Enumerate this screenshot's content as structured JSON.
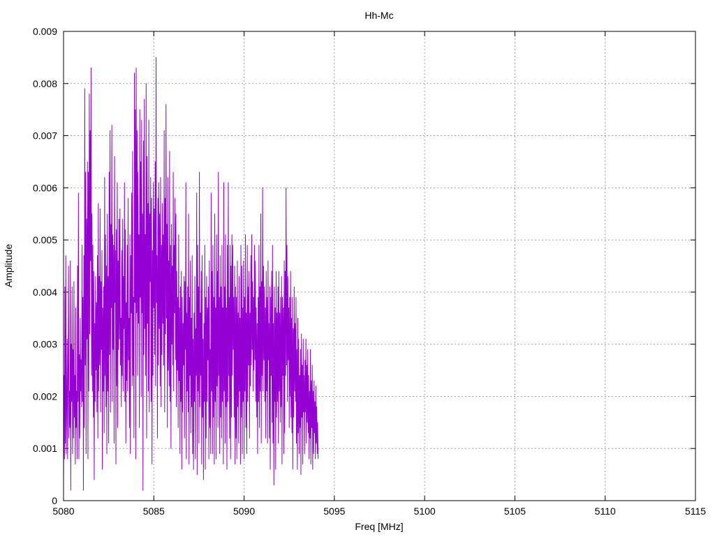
{
  "chart_data": {
    "type": "line",
    "title": "Hh-Mc",
    "xlabel": "Freq [MHz]",
    "ylabel": "Amplitude",
    "xlim": [
      5080,
      5115
    ],
    "ylim": [
      0,
      0.009
    ],
    "x_ticks": [
      5080,
      5085,
      5090,
      5095,
      5100,
      5105,
      5110,
      5115
    ],
    "y_ticks": [
      0,
      0.001,
      0.002,
      0.003,
      0.004,
      0.005,
      0.006,
      0.007,
      0.008,
      0.009
    ],
    "x_tick_labels": [
      "5080",
      "5085",
      "5090",
      "5095",
      "5100",
      "5105",
      "5110",
      "5115"
    ],
    "y_tick_labels": [
      "0",
      "0.001",
      "0.002",
      "0.003",
      "0.004",
      "0.005",
      "0.006",
      "0.007",
      "0.008",
      "0.009"
    ],
    "grid": true,
    "grid_style": "dotted",
    "line_color": "#9400d3",
    "series": [
      {
        "x_start": 5080.0,
        "x_step": 0.025,
        "values": [
          0.0004,
          0.0024,
          0.0008,
          0.0041,
          0.0011,
          0.0047,
          0.0009,
          0.0018,
          0.0031,
          0.0008,
          0.0024,
          0.0045,
          0.0012,
          0.0021,
          0.0014,
          0.0046,
          0.0002,
          0.003,
          0.0019,
          0.0041,
          0.0009,
          0.0029,
          0.0012,
          0.0042,
          0.0016,
          0.0024,
          0.0007,
          0.0037,
          0.0014,
          0.0021,
          0.0008,
          0.0045,
          0.0019,
          0.0059,
          0.0008,
          0.0028,
          0.0012,
          0.0035,
          0.0021,
          0.0027,
          0.0018,
          0.0049,
          0.0019,
          0.0039,
          0.0002,
          0.0047,
          0.0014,
          0.0079,
          0.0026,
          0.0063,
          0.0009,
          0.0054,
          0.0031,
          0.0065,
          0.0008,
          0.0063,
          0.0021,
          0.0078,
          0.0032,
          0.0071,
          0.0046,
          0.0083,
          0.0024,
          0.0055,
          0.0021,
          0.0049,
          0.0016,
          0.0044,
          0.0004,
          0.0034,
          0.0019,
          0.0043,
          0.0025,
          0.0038,
          0.0017,
          0.0047,
          0.0012,
          0.0057,
          0.0021,
          0.0043,
          0.0026,
          0.0056,
          0.0017,
          0.0042,
          0.0029,
          0.0048,
          0.0006,
          0.0037,
          0.0021,
          0.0041,
          0.0013,
          0.0062,
          0.0024,
          0.0051,
          0.0018,
          0.0045,
          0.0009,
          0.0055,
          0.0021,
          0.0043,
          0.0011,
          0.0063,
          0.0028,
          0.0071,
          0.0017,
          0.0053,
          0.0037,
          0.0072,
          0.0019,
          0.0051,
          0.0029,
          0.0049,
          0.0011,
          0.0066,
          0.0038,
          0.0048,
          0.0007,
          0.0052,
          0.0022,
          0.0061,
          0.0014,
          0.0046,
          0.0029,
          0.0054,
          0.0031,
          0.0056,
          0.0026,
          0.0035,
          0.0018,
          0.0048,
          0.0024,
          0.0054,
          0.0021,
          0.0043,
          0.0033,
          0.0061,
          0.0019,
          0.0052,
          0.0011,
          0.0038,
          0.0023,
          0.0049,
          0.0021,
          0.0058,
          0.0027,
          0.0035,
          0.0014,
          0.0051,
          0.0009,
          0.0047,
          0.0036,
          0.0059,
          0.0022,
          0.0067,
          0.0024,
          0.0039,
          0.0012,
          0.0082,
          0.0038,
          0.0075,
          0.0008,
          0.0083,
          0.0036,
          0.0071,
          0.0024,
          0.0063,
          0.0034,
          0.0051,
          0.0014,
          0.0075,
          0.0039,
          0.0065,
          0.002,
          0.0073,
          0.0036,
          0.0055,
          0.0002,
          0.0069,
          0.0028,
          0.0077,
          0.0033,
          0.0051,
          0.0024,
          0.008,
          0.0012,
          0.0066,
          0.0034,
          0.0057,
          0.0021,
          0.0073,
          0.0017,
          0.0055,
          0.0042,
          0.0062,
          0.0019,
          0.0058,
          0.0007,
          0.0048,
          0.0024,
          0.0061,
          0.0037,
          0.0056,
          0.0028,
          0.0065,
          0.0022,
          0.0085,
          0.0038,
          0.0047,
          0.0012,
          0.0058,
          0.0026,
          0.0061,
          0.0033,
          0.0055,
          0.0022,
          0.0062,
          0.0018,
          0.0049,
          0.0028,
          0.0057,
          0.0034,
          0.0051,
          0.0026,
          0.0071,
          0.0017,
          0.0058,
          0.0032,
          0.0076,
          0.0035,
          0.0053,
          0.0014,
          0.0062,
          0.0025,
          0.0046,
          0.0022,
          0.0067,
          0.0019,
          0.0049,
          0.001,
          0.0053,
          0.003,
          0.0045,
          0.0026,
          0.0063,
          0.0021,
          0.0049,
          0.0036,
          0.0058,
          0.0027,
          0.0055,
          0.0018,
          0.0044,
          0.0025,
          0.0039,
          0.0014,
          0.0051,
          0.0023,
          0.0037,
          0.0009,
          0.0041,
          0.0019,
          0.0044,
          0.0006,
          0.0039,
          0.0017,
          0.0034,
          0.0026,
          0.0043,
          0.0012,
          0.0042,
          0.0029,
          0.0061,
          0.0008,
          0.0036,
          0.0021,
          0.0041,
          0.0017,
          0.0055,
          0.0007,
          0.0039,
          0.0024,
          0.0046,
          0.0013,
          0.0035,
          0.0018,
          0.0047,
          0.0009,
          0.0031,
          0.0006,
          0.0036,
          0.0019,
          0.0043,
          0.0008,
          0.0033,
          0.0024,
          0.0059,
          0.0005,
          0.0049,
          0.0021,
          0.0041,
          0.0011,
          0.0063,
          0.0018,
          0.0036,
          0.0024,
          0.0044,
          0.0007,
          0.0047,
          0.0016,
          0.0031,
          0.0004,
          0.0034,
          0.0019,
          0.0049,
          0.0006,
          0.0039,
          0.0012,
          0.0043,
          0.0019,
          0.0037,
          0.0027,
          0.0041,
          0.0008,
          0.0046,
          0.0014,
          0.0029,
          0.0009,
          0.0059,
          0.0021,
          0.0044,
          0.0009,
          0.0049,
          0.0016,
          0.0039,
          0.0007,
          0.0055,
          0.0019,
          0.0037,
          0.0008,
          0.0051,
          0.0022,
          0.0044,
          0.0014,
          0.0063,
          0.0024,
          0.0039,
          0.0009,
          0.0047,
          0.0016,
          0.0041,
          0.0012,
          0.0049,
          0.0019,
          0.0037,
          0.0007,
          0.0061,
          0.0021,
          0.0041,
          0.0011,
          0.0051,
          0.0018,
          0.0037,
          0.0006,
          0.0049,
          0.0019,
          0.0061,
          0.0024,
          0.0039,
          0.0012,
          0.0049,
          0.0008,
          0.0045,
          0.0016,
          0.0051,
          0.0024,
          0.0049,
          0.0029,
          0.0039,
          0.0016,
          0.0045,
          0.0007,
          0.0041,
          0.0012,
          0.0039,
          0.0008,
          0.0046,
          0.0018,
          0.0036,
          0.0011,
          0.0043,
          0.0021,
          0.0035,
          0.0007,
          0.0049,
          0.0016,
          0.0045,
          0.0009,
          0.0037,
          0.0019,
          0.0046,
          0.0008,
          0.0039,
          0.0021,
          0.0051,
          0.0014,
          0.0036,
          0.0009,
          0.0049,
          0.0019,
          0.0041,
          0.0026,
          0.0044,
          0.0012,
          0.0036,
          0.0022,
          0.0047,
          0.0026,
          0.0051,
          0.0029,
          0.0042,
          0.0021,
          0.0039,
          0.0025,
          0.0049,
          0.0027,
          0.0046,
          0.0019,
          0.0037,
          0.0016,
          0.0034,
          0.0009,
          0.0039,
          0.0019,
          0.0049,
          0.0014,
          0.0041,
          0.0021,
          0.0055,
          0.0011,
          0.0042,
          0.0024,
          0.006,
          0.0021,
          0.0045,
          0.0027,
          0.0041,
          0.0019,
          0.0037,
          0.0012,
          0.0044,
          0.0021,
          0.0039,
          0.0011,
          0.0046,
          0.0027,
          0.0034,
          0.0012,
          0.0041,
          0.0006,
          0.0039,
          0.0024,
          0.0044,
          0.0015,
          0.0049,
          0.0011,
          0.0034,
          0.0003,
          0.0041,
          0.0019,
          0.0037,
          0.0006,
          0.0044,
          0.0016,
          0.0036,
          0.0019,
          0.0041,
          0.0011,
          0.0044,
          0.0021,
          0.0036,
          0.0015,
          0.0039,
          0.0018,
          0.0043,
          0.0007,
          0.0039,
          0.0024,
          0.0037,
          0.0009,
          0.0046,
          0.0013,
          0.0044,
          0.0024,
          0.006,
          0.0026,
          0.0049,
          0.0019,
          0.0043,
          0.0027,
          0.0037,
          0.0014,
          0.0039,
          0.002,
          0.0044,
          0.0016,
          0.0035,
          0.0013,
          0.0039,
          0.0006,
          0.0033,
          0.0016,
          0.0041,
          0.0021,
          0.0034,
          0.0019,
          0.0039,
          0.0011,
          0.0029,
          0.0006,
          0.0035,
          0.0013,
          0.0031,
          0.0009,
          0.0024,
          0.0014,
          0.0029,
          0.0005,
          0.0032,
          0.0016,
          0.0026,
          0.0007,
          0.0031,
          0.0017,
          0.0024,
          0.0009,
          0.0027,
          0.0017,
          0.0031,
          0.0011,
          0.0026,
          0.0015,
          0.0029,
          0.0013,
          0.0024,
          0.0008,
          0.0021,
          0.0012,
          0.0029,
          0.0007,
          0.0023,
          0.0014,
          0.0026,
          0.0006,
          0.0021,
          0.0009,
          0.0023,
          0.0013,
          0.0019,
          0.0008,
          0.0022,
          0.0011,
          0.0018,
          0.0009,
          0.0015,
          0.0008
        ]
      }
    ]
  }
}
